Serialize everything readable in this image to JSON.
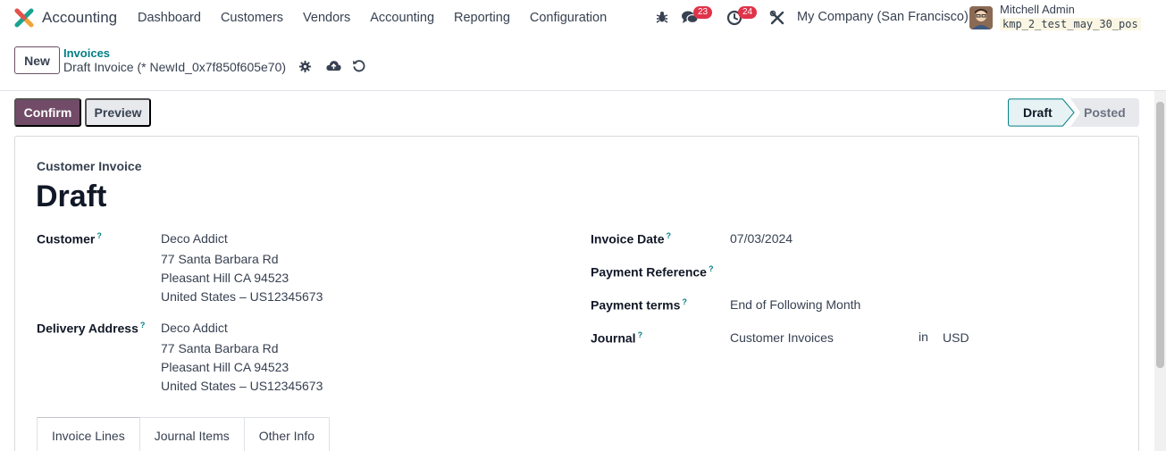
{
  "navbar": {
    "app_name": "Accounting",
    "menu": [
      "Dashboard",
      "Customers",
      "Vendors",
      "Accounting",
      "Reporting",
      "Configuration"
    ],
    "messages_count": "23",
    "activities_count": "24",
    "company": "My Company (San Francisco)",
    "user_name": "Mitchell Admin",
    "db_name": "kmp_2_test_may_30_pos"
  },
  "control_panel": {
    "new_label": "New",
    "breadcrumb_parent": "Invoices",
    "breadcrumb_current": "Draft Invoice (* NewId_0x7f850f605e70)"
  },
  "actions": {
    "confirm_label": "Confirm",
    "preview_label": "Preview"
  },
  "status": {
    "stages": [
      "Draft",
      "Posted"
    ],
    "current": "Draft"
  },
  "form": {
    "subtitle": "Customer Invoice",
    "title": "Draft",
    "customer_label": "Customer",
    "customer_lines": [
      "Deco Addict",
      "77 Santa Barbara Rd",
      "Pleasant Hill CA 94523",
      "United States – US12345673"
    ],
    "delivery_label": "Delivery Address",
    "delivery_lines": [
      "Deco Addict",
      "77 Santa Barbara Rd",
      "Pleasant Hill CA 94523",
      "United States – US12345673"
    ],
    "invoice_date_label": "Invoice Date",
    "invoice_date": "07/03/2024",
    "payment_reference_label": "Payment Reference",
    "payment_terms_label": "Payment terms",
    "payment_terms": "End of Following Month",
    "journal_label": "Journal",
    "journal": "Customer Invoices",
    "in_label": "in",
    "currency": "USD",
    "help_mark": "?"
  },
  "tabs": [
    "Invoice Lines",
    "Journal Items",
    "Other Info"
  ],
  "colors": {
    "brand": "#714b67",
    "link": "#017e84",
    "badge": "#e0334a"
  }
}
